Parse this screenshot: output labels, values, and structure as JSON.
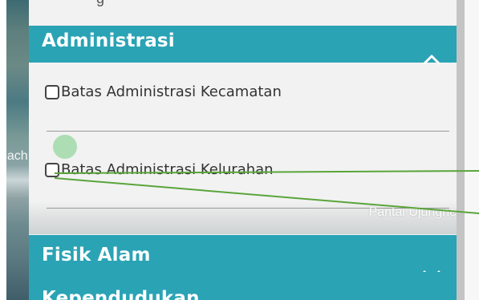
{
  "map": {
    "edge_label": "each",
    "place_label": "Pantai Ujungne"
  },
  "top_clipped_text": "–  – g –",
  "sections": [
    {
      "title": "Administrasi",
      "expanded": true,
      "items": [
        {
          "label": "Batas Administrasi Kecamatan",
          "checked": false
        },
        {
          "label": "Batas Administrasi Kelurahan",
          "checked": false
        }
      ]
    },
    {
      "title": "Fisik Alam",
      "expanded": false
    },
    {
      "title": "Kependudukan",
      "expanded": false
    }
  ],
  "colors": {
    "header": "#2aa3b5",
    "annotation_line": "#5aa53a"
  },
  "icons": {
    "expand": "chevron-up-icon",
    "collapse": "chevron-down-icon"
  }
}
